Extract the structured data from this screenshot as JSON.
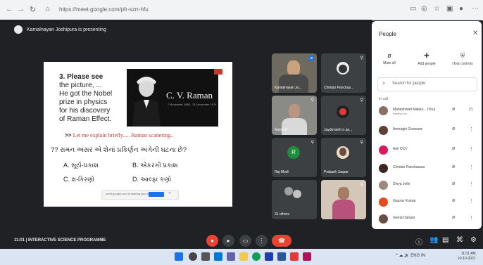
{
  "browser": {
    "url": "https://meet.google.com/pfr-szrr-hfu"
  },
  "meet": {
    "presenting_label": "Kamalnayan Joshipura is presenting",
    "meeting_title": "11:01 | INTERACTIVE SCIENCE PROGRAMME"
  },
  "slide": {
    "question_number": "3. Please see",
    "question_lines": [
      "the picture, ...",
      "He got the Nobel",
      "prize in physics",
      "for his discovery",
      "of Raman Effect."
    ],
    "portrait_name": "C. V. Raman",
    "portrait_dates": "7 November 1888 - 21 November 1970",
    "explain_prefix": ">>",
    "explain_text": "Let me explain briefly..... Raman scattering..",
    "question_gujarati": "?? રામન અસર એ શેનાં પ્રકિર્ણન અંગેની ઘટના છે?",
    "options": [
      "A. સૂર્ય-પ્રકાશ",
      "B. એકરંગી પ્રકાશ",
      "C. ક્ષ-કિરણો",
      "D. આલ્ફા કણો"
    ],
    "popup_text": "meet.google.com is sharing your screen"
  },
  "tiles": [
    {
      "name": "Kamalnayan Jo...",
      "type": "video"
    },
    {
      "name": "Chintan Panchas...",
      "type": "avatar"
    },
    {
      "name": "Amrut R",
      "type": "video"
    },
    {
      "name": "Jaydevsinh n pa...",
      "type": "avatar"
    },
    {
      "name": "Raj Modi",
      "type": "initial",
      "initial": "R"
    },
    {
      "name": "Prakash Jaspar",
      "type": "avatar"
    },
    {
      "name": "31 others",
      "type": "others"
    },
    {
      "name": "",
      "type": "video"
    }
  ],
  "panel": {
    "title": "People",
    "actions": [
      {
        "label": "Mute all",
        "icon": "mic-off-icon"
      },
      {
        "label": "Add people",
        "icon": "add-person-icon"
      },
      {
        "label": "Host controls",
        "icon": "shield-icon"
      }
    ],
    "search_placeholder": "Search for people",
    "section_label": "In call",
    "people": [
      {
        "name": "Maheshwari Malqui... (You)",
        "sub": "Meeting host",
        "color": "#8d6e63"
      },
      {
        "name": "Amrutgiri Goswami",
        "sub": "",
        "color": "#5d4037"
      },
      {
        "name": "Anil OCV",
        "sub": "",
        "color": "#d81b60"
      },
      {
        "name": "Chintan Panchasara",
        "sub": "",
        "color": "#3e2723"
      },
      {
        "name": "Divya Jethi",
        "sub": "",
        "color": "#a1887f"
      },
      {
        "name": "Gaurav Kumar",
        "sub": "",
        "color": "#e64a19"
      },
      {
        "name": "Geeta Dangar",
        "sub": "",
        "color": "#6d4c41"
      }
    ]
  },
  "taskbar": {
    "lang": "ENG IN",
    "time": "11:01 AM",
    "date": "10-10-2021"
  },
  "colors": {
    "end_call": "#ea4335",
    "stage": "#202124",
    "accent": "#1a73e8"
  }
}
